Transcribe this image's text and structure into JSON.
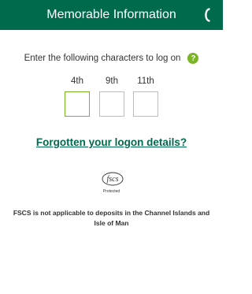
{
  "header": {
    "title": "Memorable Information",
    "phone_icon": "phone-icon"
  },
  "colors": {
    "brand_green": "#006a4d",
    "accent_green": "#7ab526",
    "box_border": "#bdbdbd",
    "text": "#333333"
  },
  "instruction": {
    "text": "Enter the following characters to log on",
    "help_icon_glyph": "?"
  },
  "characters": [
    {
      "label": "4th",
      "value": ""
    },
    {
      "label": "9th",
      "value": ""
    },
    {
      "label": "11th",
      "value": ""
    }
  ],
  "forgot_link": "Forgotten your logon details?",
  "fscs": {
    "logo_text": "fscs",
    "protected_text": "Protected",
    "note": "FSCS is not applicable to deposits in the Channel Islands and Isle of Man"
  }
}
